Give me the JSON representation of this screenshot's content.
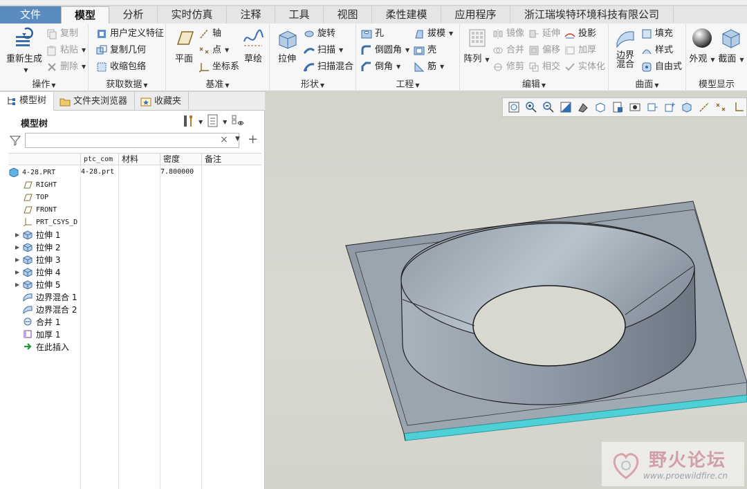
{
  "ribbon_tabs": [
    "文件",
    "模型",
    "分析",
    "实时仿真",
    "注释",
    "工具",
    "视图",
    "柔性建模",
    "应用程序",
    "浙江瑞埃特环境科技有限公司"
  ],
  "groups": {
    "operations": {
      "label": "操作",
      "regenerate": "重新生成",
      "copy": "复制",
      "paste": "粘贴",
      "delete": "删除"
    },
    "get_data": {
      "label": "获取数据",
      "udf": "用户定义特征",
      "copy_geom": "复制几何",
      "shrinkwrap": "收缩包络"
    },
    "datum": {
      "label": "基准",
      "plane": "平面",
      "axis": "轴",
      "point": "点",
      "csys": "坐标系",
      "sketch": "草绘"
    },
    "shapes": {
      "label": "形状",
      "extrude": "拉伸",
      "revolve": "旋转",
      "sweep": "扫描",
      "swept_blend": "扫描混合"
    },
    "engineering": {
      "label": "工程",
      "hole": "孔",
      "round": "倒圆角",
      "chamfer": "倒角",
      "draft": "拔模",
      "shell": "壳",
      "rib": "筋"
    },
    "editing": {
      "label": "编辑",
      "pattern": "阵列",
      "mirror": "镜像",
      "merge": "合并",
      "trim": "修剪",
      "extend": "延伸",
      "offset": "偏移",
      "intersect": "相交",
      "project": "投影",
      "thicken": "加厚",
      "solidify": "实体化"
    },
    "surfaces": {
      "label": "曲面",
      "boundary_blend": "边界\n混合",
      "fill": "填充",
      "style": "样式",
      "freestyle": "自由式"
    },
    "model_display": {
      "label": "模型显示",
      "appearance": "外观",
      "section": "截面"
    }
  },
  "panel_tabs": [
    "模型树",
    "文件夹浏览器",
    "收藏夹"
  ],
  "tree": {
    "header": "模型树",
    "columns": [
      "ptc_com",
      "材料",
      "密度",
      "备注"
    ],
    "root": {
      "name": "4-28.PRT",
      "ptc_common_name": "4-28.prt",
      "density": "7.800000"
    },
    "items": [
      {
        "label": "RIGHT",
        "icon": "datum-plane-icon",
        "expandable": false,
        "mono": true
      },
      {
        "label": "TOP",
        "icon": "datum-plane-icon",
        "expandable": false,
        "mono": true
      },
      {
        "label": "FRONT",
        "icon": "datum-plane-icon",
        "expandable": false,
        "mono": true
      },
      {
        "label": "PRT_CSYS_D",
        "icon": "csys-icon",
        "expandable": false,
        "mono": true
      },
      {
        "label": "拉伸 1",
        "icon": "extrude-icon",
        "expandable": true,
        "mono": false
      },
      {
        "label": "拉伸 2",
        "icon": "extrude-icon",
        "expandable": true,
        "mono": false
      },
      {
        "label": "拉伸 3",
        "icon": "extrude-icon",
        "expandable": true,
        "mono": false
      },
      {
        "label": "拉伸 4",
        "icon": "extrude-icon",
        "expandable": true,
        "mono": false
      },
      {
        "label": "拉伸 5",
        "icon": "extrude-icon",
        "expandable": true,
        "mono": false
      },
      {
        "label": "边界混合 1",
        "icon": "boundary-blend-icon",
        "expandable": false,
        "mono": false
      },
      {
        "label": "边界混合 2",
        "icon": "boundary-blend-icon",
        "expandable": false,
        "mono": false
      },
      {
        "label": "合并 1",
        "icon": "merge-icon",
        "expandable": false,
        "mono": false
      },
      {
        "label": "加厚 1",
        "icon": "thicken-icon",
        "expandable": false,
        "mono": false
      },
      {
        "label": "在此插入",
        "icon": "insert-here-icon",
        "expandable": false,
        "mono": false
      }
    ]
  },
  "filter": {
    "placeholder": "",
    "value": ""
  },
  "watermark": {
    "title": "野火论坛",
    "url": "www.proewildfire.cn"
  },
  "colors": {
    "file_tab": "#5a8bbf",
    "accent_blue": "#2f6db5",
    "model_face": "#9aa6b1",
    "model_edge_cyan": "#4fd0d6",
    "viewport_bg": "#d6d5ce"
  }
}
